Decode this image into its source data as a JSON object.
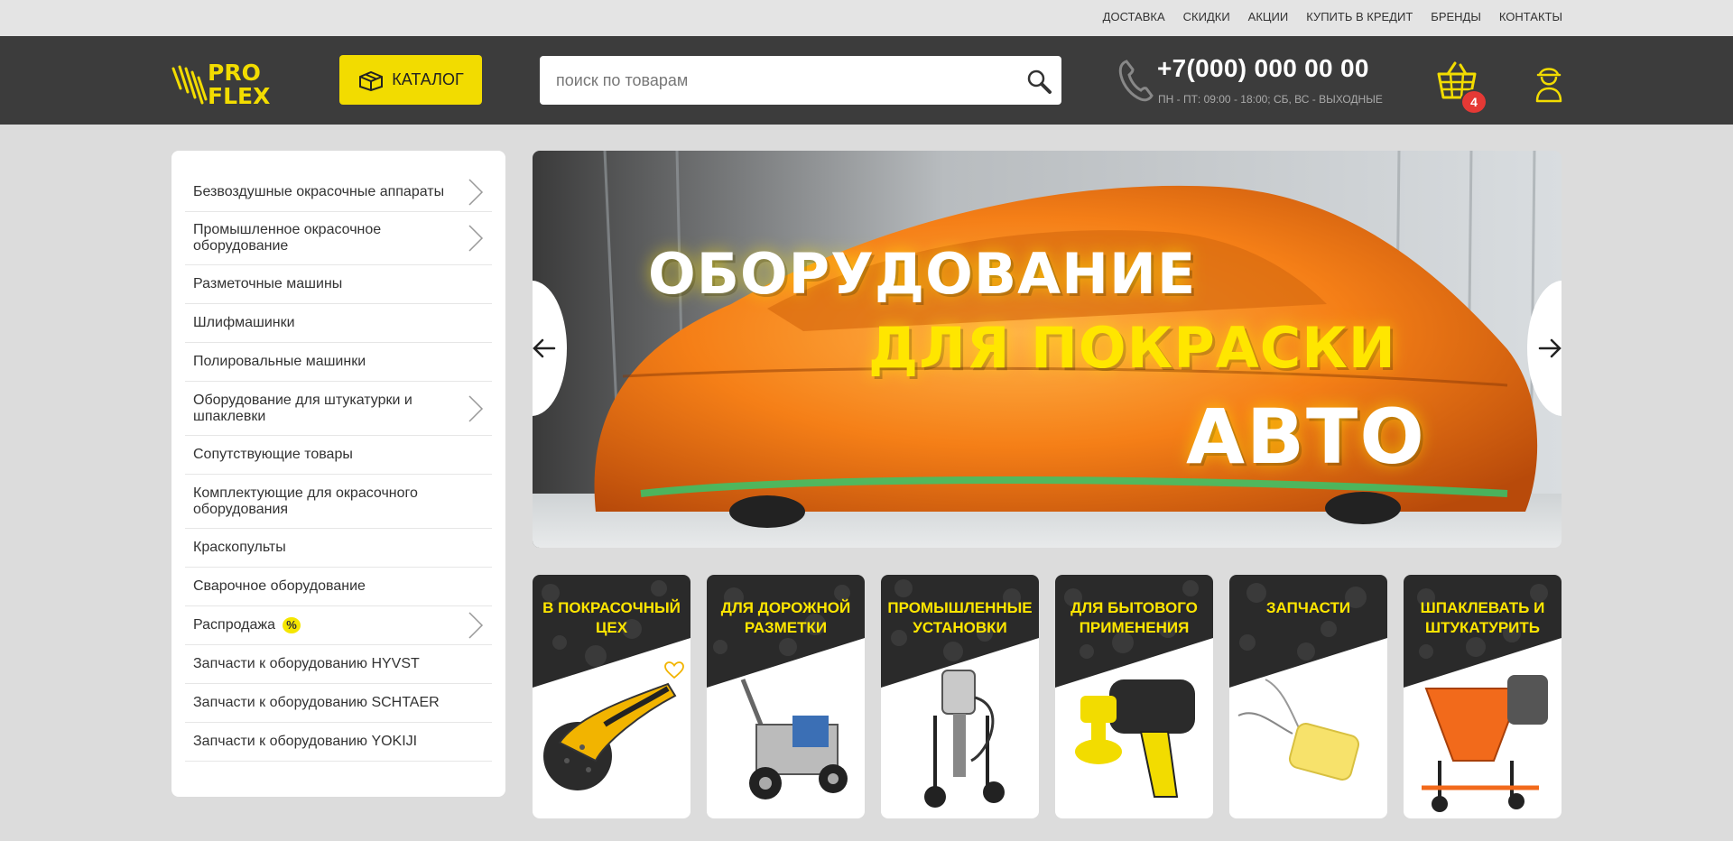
{
  "top_links": [
    "ДОСТАВКА",
    "СКИДКИ",
    "АКЦИИ",
    "КУПИТЬ В КРЕДИТ",
    "БРЕНДЫ",
    "КОНТАКТЫ"
  ],
  "header": {
    "logo_top": "PRO",
    "logo_bottom": "FLEX",
    "catalog_label": "КАТАЛОГ",
    "search_placeholder": "поиск по товарам",
    "phone": "+7(000) 000 00 00",
    "hours": "ПН - ПТ: 09:00 - 18:00; СБ, ВС - ВЫХОДНЫЕ",
    "cart_count": "4"
  },
  "sidebar": {
    "items": [
      {
        "label": "Безвоздушные окрасочные аппараты",
        "has_submenu": true
      },
      {
        "label": "Промышленное окрасочное оборудование",
        "has_submenu": true
      },
      {
        "label": "Разметочные машины",
        "has_submenu": false
      },
      {
        "label": "Шлифмашинки",
        "has_submenu": false
      },
      {
        "label": "Полировальные машинки",
        "has_submenu": false
      },
      {
        "label": "Оборудование для штукатурки и шпаклевки",
        "has_submenu": true
      },
      {
        "label": "Сопутствующие товары",
        "has_submenu": false
      },
      {
        "label": "Комплектующие для окрасочного оборудования",
        "has_submenu": false
      },
      {
        "label": "Краскопульты",
        "has_submenu": false
      },
      {
        "label": "Сварочное оборудование",
        "has_submenu": false
      },
      {
        "label": "Распродажа",
        "has_submenu": true,
        "badge": "%"
      },
      {
        "label": "Запчасти к оборудованию HYVST",
        "has_submenu": false
      },
      {
        "label": "Запчасти к оборудованию SCHTAER",
        "has_submenu": false
      },
      {
        "label": "Запчасти к оборудованию YOKIJI",
        "has_submenu": false
      }
    ]
  },
  "banner": {
    "line1": "ОБОРУДОВАНИЕ",
    "line2": "ДЛЯ ПОКРАСКИ",
    "line3": "АВТО"
  },
  "tiles": [
    {
      "title": "В ПОКРАСОЧНЫЙ ЦЕХ",
      "image": "orbital-sander"
    },
    {
      "title": "ДЛЯ ДОРОЖНОЙ РАЗМЕТКИ",
      "image": "line-marking-machine"
    },
    {
      "title": "ПРОМЫШЛЕННЫЕ УСТАНОВКИ",
      "image": "industrial-sprayer"
    },
    {
      "title": "ДЛЯ БЫТОВОГО ПРИМЕНЕНИЯ",
      "image": "spray-gun"
    },
    {
      "title": "ЗАПЧАСТИ",
      "image": "filter-part"
    },
    {
      "title": "ШПАКЛЕВАТЬ И ШТУКАТУРИТЬ",
      "image": "plaster-machine"
    }
  ],
  "colors": {
    "accent": "#f2dc00",
    "header_bg": "#3c3c3c",
    "badge": "#e53935"
  }
}
